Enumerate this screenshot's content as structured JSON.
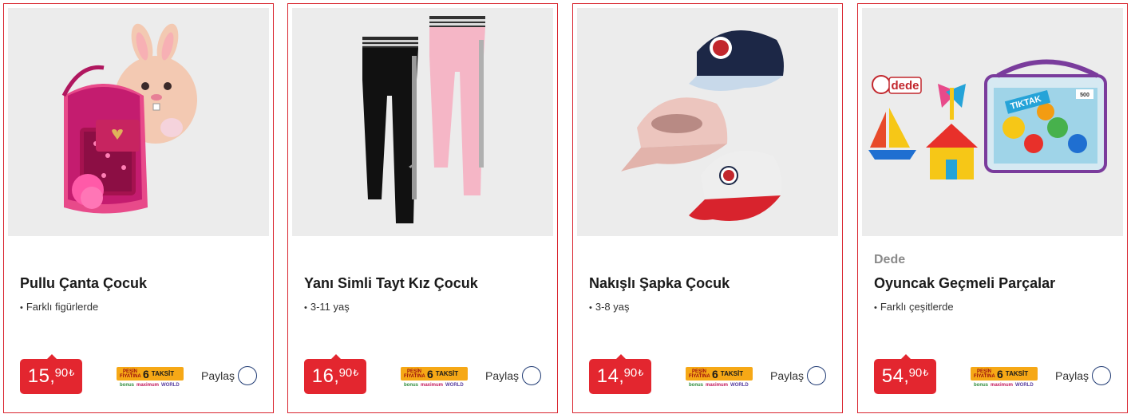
{
  "share_label": "Paylaş",
  "installment": {
    "pesin_text": "PEŞİN FİYATINA",
    "count": "6",
    "word": "TAKSİT",
    "brands": [
      "bonus",
      "maximum",
      "WORLD"
    ]
  },
  "colors": {
    "accent": "#e3262f",
    "border": "#d9252f",
    "taksit": "#f6a816",
    "share_ring": "#1f3a73"
  },
  "products": [
    {
      "brand": "",
      "title": "Pullu Çanta Çocuk",
      "feature": "Farklı figürlerde",
      "price": {
        "int": "15",
        "dec": "90",
        "currency": "₺"
      },
      "image": "sequin-backpack-and-bunny-bag"
    },
    {
      "brand": "",
      "title": "Yanı Simli Tayt Kız Çocuk",
      "feature": "3-11 yaş",
      "price": {
        "int": "16",
        "dec": "90",
        "currency": "₺"
      },
      "image": "black-and-pink-leggings"
    },
    {
      "brand": "",
      "title": "Nakışlı Şapka Çocuk",
      "feature": "3-8 yaş",
      "price": {
        "int": "14",
        "dec": "90",
        "currency": "₺"
      },
      "image": "three-kids-caps"
    },
    {
      "brand": "Dede",
      "title": "Oyuncak Geçmeli Parçalar",
      "feature": "Farklı çeşitlerde",
      "price": {
        "int": "54",
        "dec": "90",
        "currency": "₺"
      },
      "image": "building-blocks-box",
      "image_texts": {
        "logo": "dede",
        "box": "TIKTAK",
        "box_count": "500"
      }
    }
  ]
}
